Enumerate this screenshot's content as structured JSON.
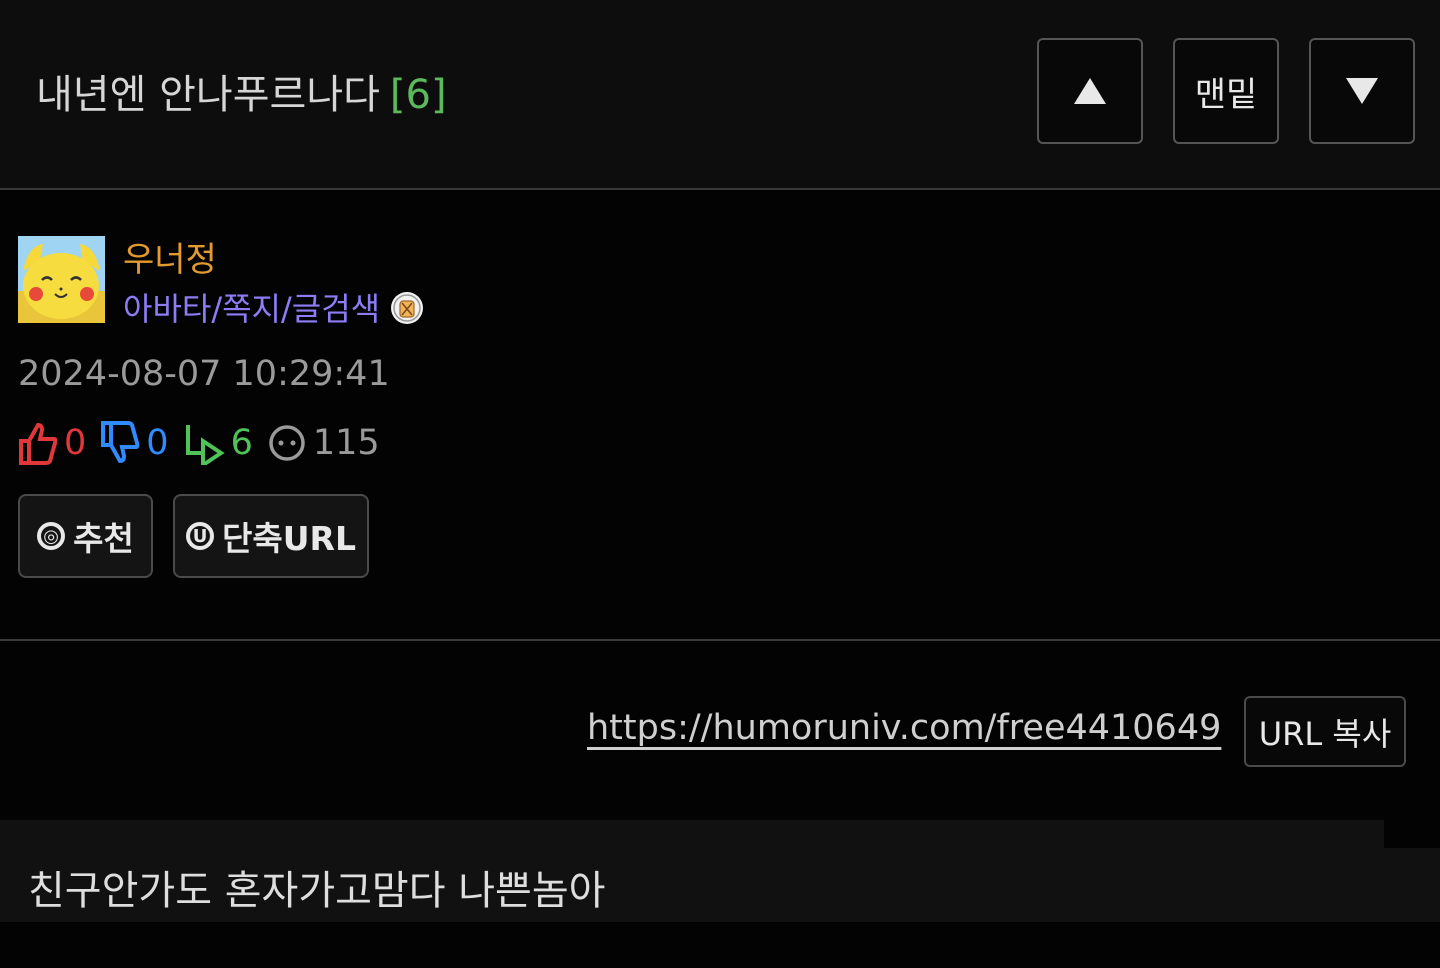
{
  "header": {
    "title": "내년엔 안나푸르나다",
    "reply_count": "[6]",
    "btn_up_icon": "triangle-up-icon",
    "btn_bottom_label": "맨밑",
    "btn_down_icon": "triangle-down-icon"
  },
  "author": {
    "name": "우너정",
    "links": "아바타/쪽지/글검색",
    "avatar_icon": "pikachu-avatar",
    "badge_icon": "medal-badge-icon"
  },
  "post": {
    "date": "2024-08-07 10:29:41",
    "stats": {
      "likes": "0",
      "dislikes": "0",
      "replies": "6",
      "views": "115"
    },
    "recommend_label": "추천",
    "shorturl_label": "단축URL",
    "url": "https://humoruniv.com/free4410649",
    "copy_label": "URL 복사",
    "content": "친구안가도 혼자가고맘다 나쁜놈아"
  },
  "colors": {
    "author_name": "#e39a2f",
    "author_links": "#8c7cf5",
    "reply_count": "#5cb85c",
    "likes": "#e0373b",
    "dislikes": "#2f8bff",
    "replies": "#4fc25a"
  }
}
